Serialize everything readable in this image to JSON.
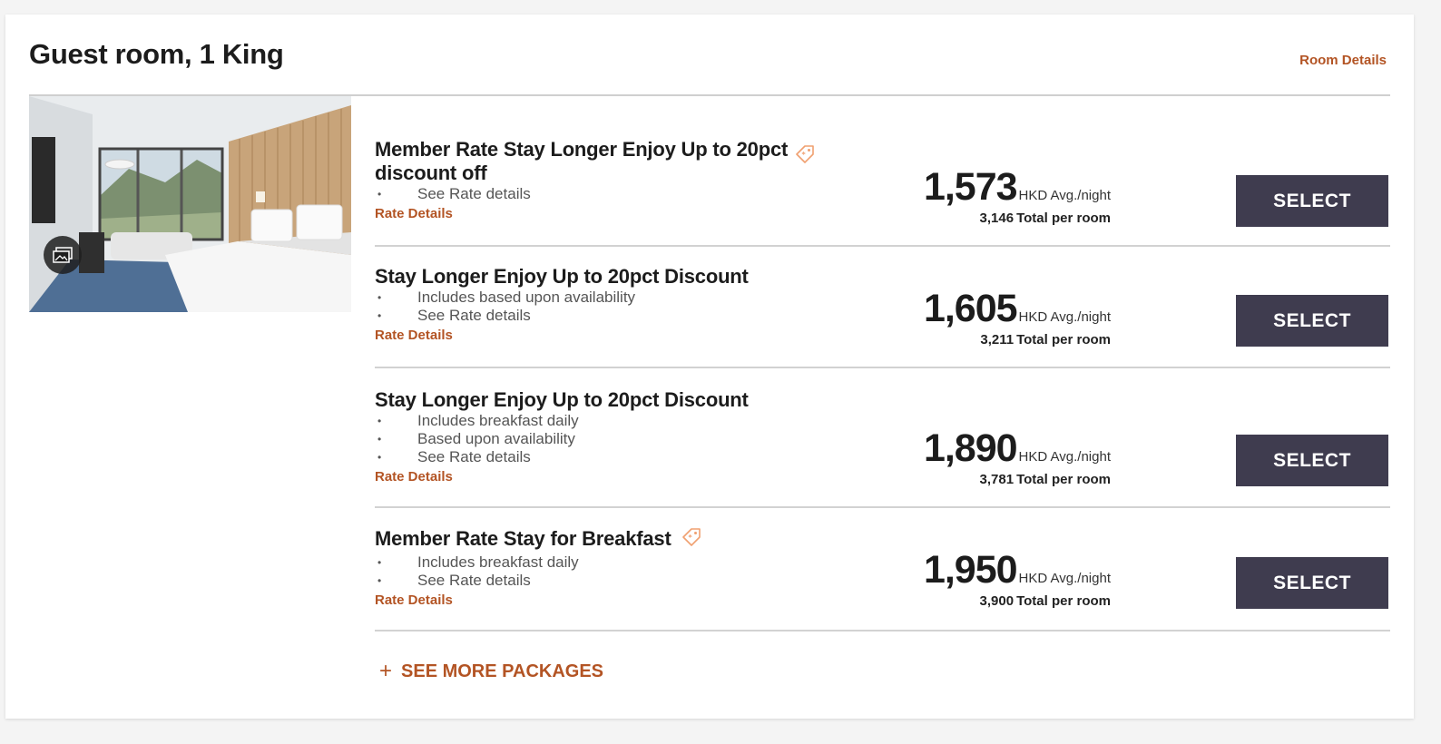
{
  "room": {
    "title": "Guest room, 1 King",
    "details_link": "Room Details"
  },
  "rates": [
    {
      "name": "Member Rate Stay Longer Enjoy Up to 20pct discount off",
      "member_tag": true,
      "features": [
        "See Rate details"
      ],
      "details_link": "Rate Details",
      "price": "1,573",
      "price_unit": "HKD Avg./night",
      "total": "3,146",
      "total_label": "Total per room",
      "select_label": "SELECT"
    },
    {
      "name": "Stay Longer Enjoy Up to 20pct Discount",
      "member_tag": false,
      "features": [
        "Includes based upon availability",
        "See Rate details"
      ],
      "details_link": "Rate Details",
      "price": "1,605",
      "price_unit": "HKD Avg./night",
      "total": "3,211",
      "total_label": "Total per room",
      "select_label": "SELECT"
    },
    {
      "name": "Stay Longer Enjoy Up to 20pct Discount",
      "member_tag": false,
      "features": [
        "Includes breakfast daily",
        "Based upon availability",
        "See Rate details"
      ],
      "details_link": "Rate Details",
      "price": "1,890",
      "price_unit": "HKD Avg./night",
      "total": "3,781",
      "total_label": "Total per room",
      "select_label": "SELECT"
    },
    {
      "name": "Member Rate Stay for Breakfast",
      "member_tag": true,
      "features": [
        "Includes breakfast daily",
        "See Rate details"
      ],
      "details_link": "Rate Details",
      "price": "1,950",
      "price_unit": "HKD Avg./night",
      "total": "3,900",
      "total_label": "Total per room",
      "select_label": "SELECT"
    }
  ],
  "more_packages": {
    "icon": "plus-icon",
    "label": "SEE MORE PACKAGES"
  },
  "icons": {
    "gallery": "gallery-icon",
    "member_tag": "member-tag-icon"
  },
  "colors": {
    "accent": "#b35424",
    "button": "#3f3c4f",
    "tag": "#f0a070"
  }
}
